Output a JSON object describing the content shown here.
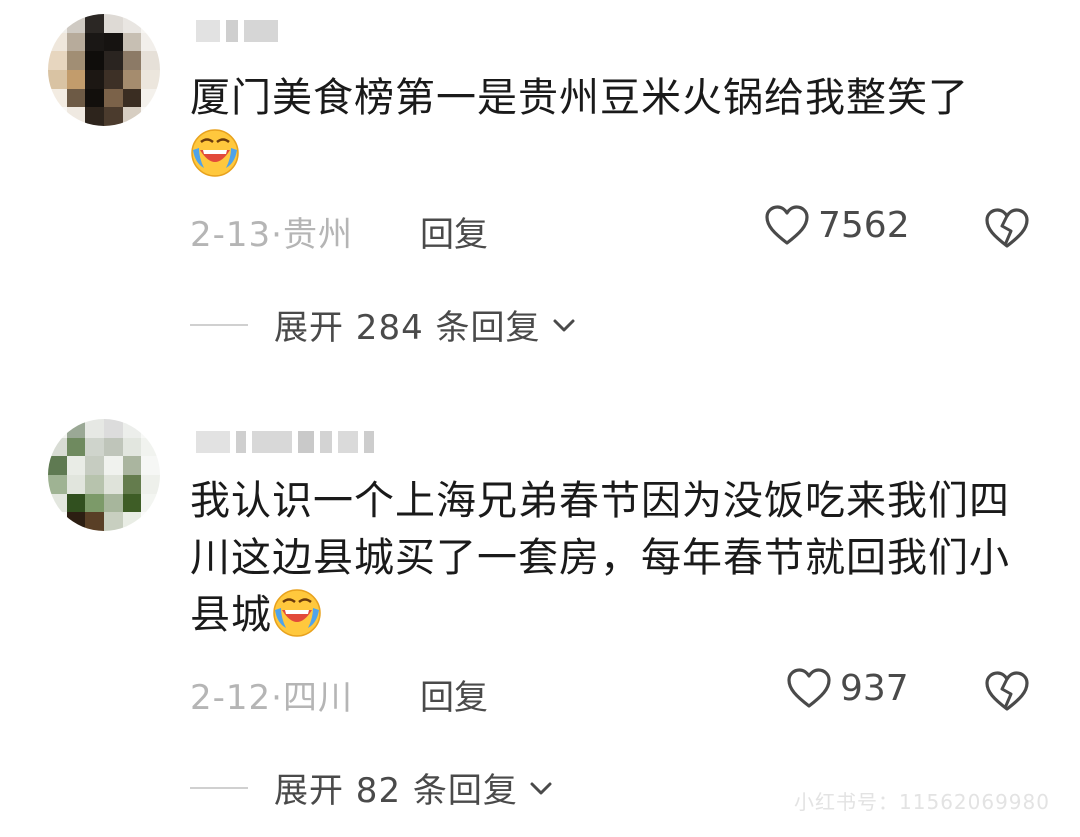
{
  "comments": [
    {
      "text": "厦门美食榜第一是贵州豆米火锅给我整笑了",
      "emoji_icon": "laughing-crying-emoji-icon",
      "meta": "2-13·贵州",
      "reply_label": "回复",
      "like_count": "7562",
      "expand_label": "展开 284 条回复"
    },
    {
      "text": "我认识一个上海兄弟春节因为没饭吃来我们四川这边县城买了一套房，每年春节就回我们小县城",
      "emoji_icon": "laughing-crying-emoji-icon",
      "meta": "2-12·四川",
      "reply_label": "回复",
      "like_count": "937",
      "expand_label": "展开 82 条回复"
    }
  ],
  "watermark": "小红书号：11562069980",
  "colors": {
    "text_primary": "#1a1a1a",
    "text_secondary": "#4a4a4a",
    "text_meta": "#b5b5b5",
    "divider": "#d0d0d0"
  }
}
